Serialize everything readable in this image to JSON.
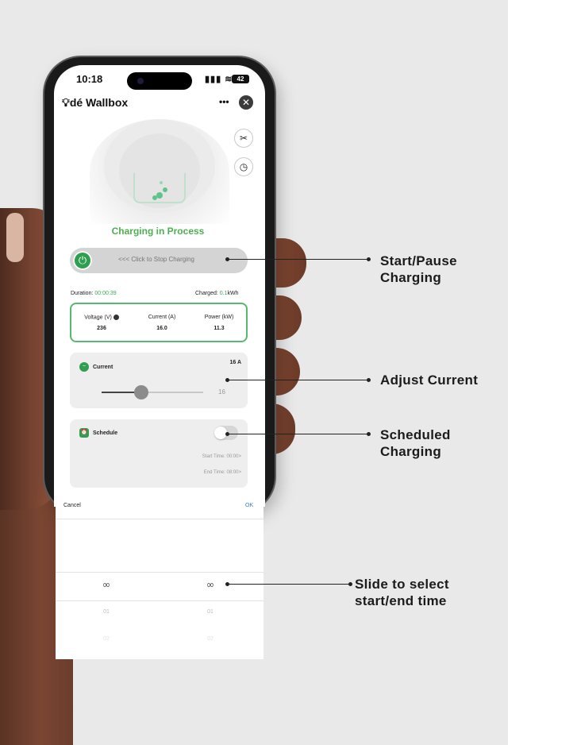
{
  "status_bar": {
    "time": "10:18",
    "signal": "▮▮▮ ≋",
    "battery": "42"
  },
  "header": {
    "title": "dé Wallbox",
    "more": "•••",
    "close": "✕"
  },
  "charger": {
    "status": "Charging in Process",
    "stop_slider_label": "<<< Click to Stop Charging",
    "duration_label": "Duration:",
    "duration_value": "00:00:39",
    "charged_label": "Charged:",
    "charged_value": "0.1",
    "charged_unit": "kWh"
  },
  "metrics": [
    {
      "label": "Voltage (V)",
      "value": "236"
    },
    {
      "label": "Current (A)",
      "value": "16.0"
    },
    {
      "label": "Power (kW)",
      "value": "11.3"
    }
  ],
  "current_card": {
    "title": "Current",
    "value": "16 A",
    "slider_value": "16",
    "slider_fraction": 0.39
  },
  "schedule_card": {
    "title": "Schedule",
    "enabled": false,
    "start_time": "Start Time: 00:00>",
    "end_time": "End Time: 08:00>"
  },
  "picker": {
    "cancel": "Cancel",
    "ok": "OK",
    "rows": [
      {
        "left": "00",
        "right": "00"
      },
      {
        "left": "01",
        "right": "01"
      },
      {
        "left": "02",
        "right": "02"
      }
    ]
  },
  "callouts": [
    {
      "text": "Start/Pause\nCharging"
    },
    {
      "text": "Adjust Current"
    },
    {
      "text": "Scheduled\nCharging"
    },
    {
      "text": "Slide to select\nstart/end time"
    }
  ],
  "colors": {
    "accent_green": "#4caf50",
    "link_blue": "#2f7fd6",
    "background": "#e9e9e9"
  }
}
